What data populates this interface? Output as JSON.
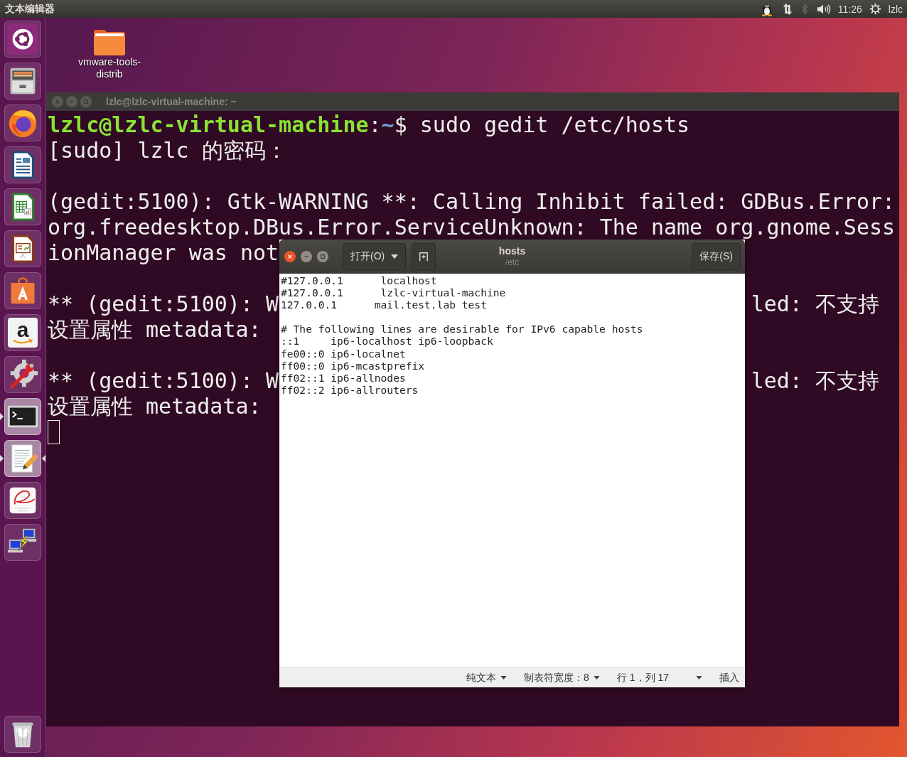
{
  "top_bar": {
    "app_name": "文本编辑器",
    "indicators": [
      {
        "kind": "penguin"
      },
      {
        "kind": "network"
      },
      {
        "kind": "bluetooth"
      },
      {
        "kind": "volume"
      }
    ],
    "clock": "11:26",
    "user": "lzlc"
  },
  "launcher": {
    "items": [
      {
        "kind": "dash",
        "running": false,
        "focused": false
      },
      {
        "kind": "files",
        "running": false,
        "focused": false
      },
      {
        "kind": "browser",
        "running": false,
        "focused": false
      },
      {
        "kind": "writer",
        "running": false,
        "focused": false
      },
      {
        "kind": "calc",
        "running": false,
        "focused": false
      },
      {
        "kind": "impress",
        "running": false,
        "focused": false
      },
      {
        "kind": "software",
        "running": false,
        "focused": false
      },
      {
        "kind": "amazon",
        "glyph": "a",
        "running": false,
        "focused": false
      },
      {
        "kind": "settings",
        "running": false,
        "focused": false
      },
      {
        "kind": "terminal",
        "running": true,
        "focused": false
      },
      {
        "kind": "editor",
        "running": true,
        "focused": true
      },
      {
        "kind": "viewer",
        "running": false,
        "focused": false
      },
      {
        "kind": "remote",
        "running": false,
        "focused": false
      },
      {
        "kind": "trash",
        "running": false,
        "focused": false
      }
    ]
  },
  "desktop_icons": [
    {
      "label": "vmware-tools-distrib"
    }
  ],
  "terminal": {
    "title": "lzlc@lzlc-virtual-machine: ~",
    "lines": [
      {
        "kind": "prompt",
        "user": "lzlc@lzlc-virtual-machine",
        "separator": ":",
        "path": "~",
        "command": "$ sudo gedit /etc/hosts"
      },
      {
        "kind": "text",
        "text": "[sudo] lzlc 的密码："
      },
      {
        "kind": "blank"
      },
      {
        "kind": "text",
        "text": "(gedit:5100): Gtk-WARNING **: Calling Inhibit failed: GDBus.Error:"
      },
      {
        "kind": "text",
        "text": "org.freedesktop.DBus.Error.ServiceUnknown: The name org.gnome.Sess"
      },
      {
        "kind": "text",
        "text": "ionManager was not"
      },
      {
        "kind": "blank"
      },
      {
        "kind": "split",
        "left": "** (gedit:5100): W",
        "right": "led: 不支持"
      },
      {
        "kind": "text",
        "text": "设置属性 metadata:"
      },
      {
        "kind": "blank"
      },
      {
        "kind": "split",
        "left": "** (gedit:5100): W",
        "right": "led: 不支持"
      },
      {
        "kind": "text",
        "text": "设置属性 metadata:"
      },
      {
        "kind": "cursor"
      }
    ]
  },
  "editor": {
    "title": "hosts",
    "subtitle": "/etc",
    "open_button": "打开(O)",
    "save_button": "保存(S)",
    "content": "#127.0.0.1      localhost\n#127.0.0.1      lzlc-virtual-machine\n127.0.0.1      mail.test.lab test\n\n# The following lines are desirable for IPv6 capable hosts\n::1     ip6-localhost ip6-loopback\nfe00::0 ip6-localnet\nff00::0 ip6-mcastprefix\nff02::1 ip6-allnodes\nff02::2 ip6-allrouters",
    "status_bar": {
      "language": "纯文本",
      "tab_width": "制表符宽度：8",
      "position": "行 1，列 17",
      "mode": "插入"
    }
  }
}
